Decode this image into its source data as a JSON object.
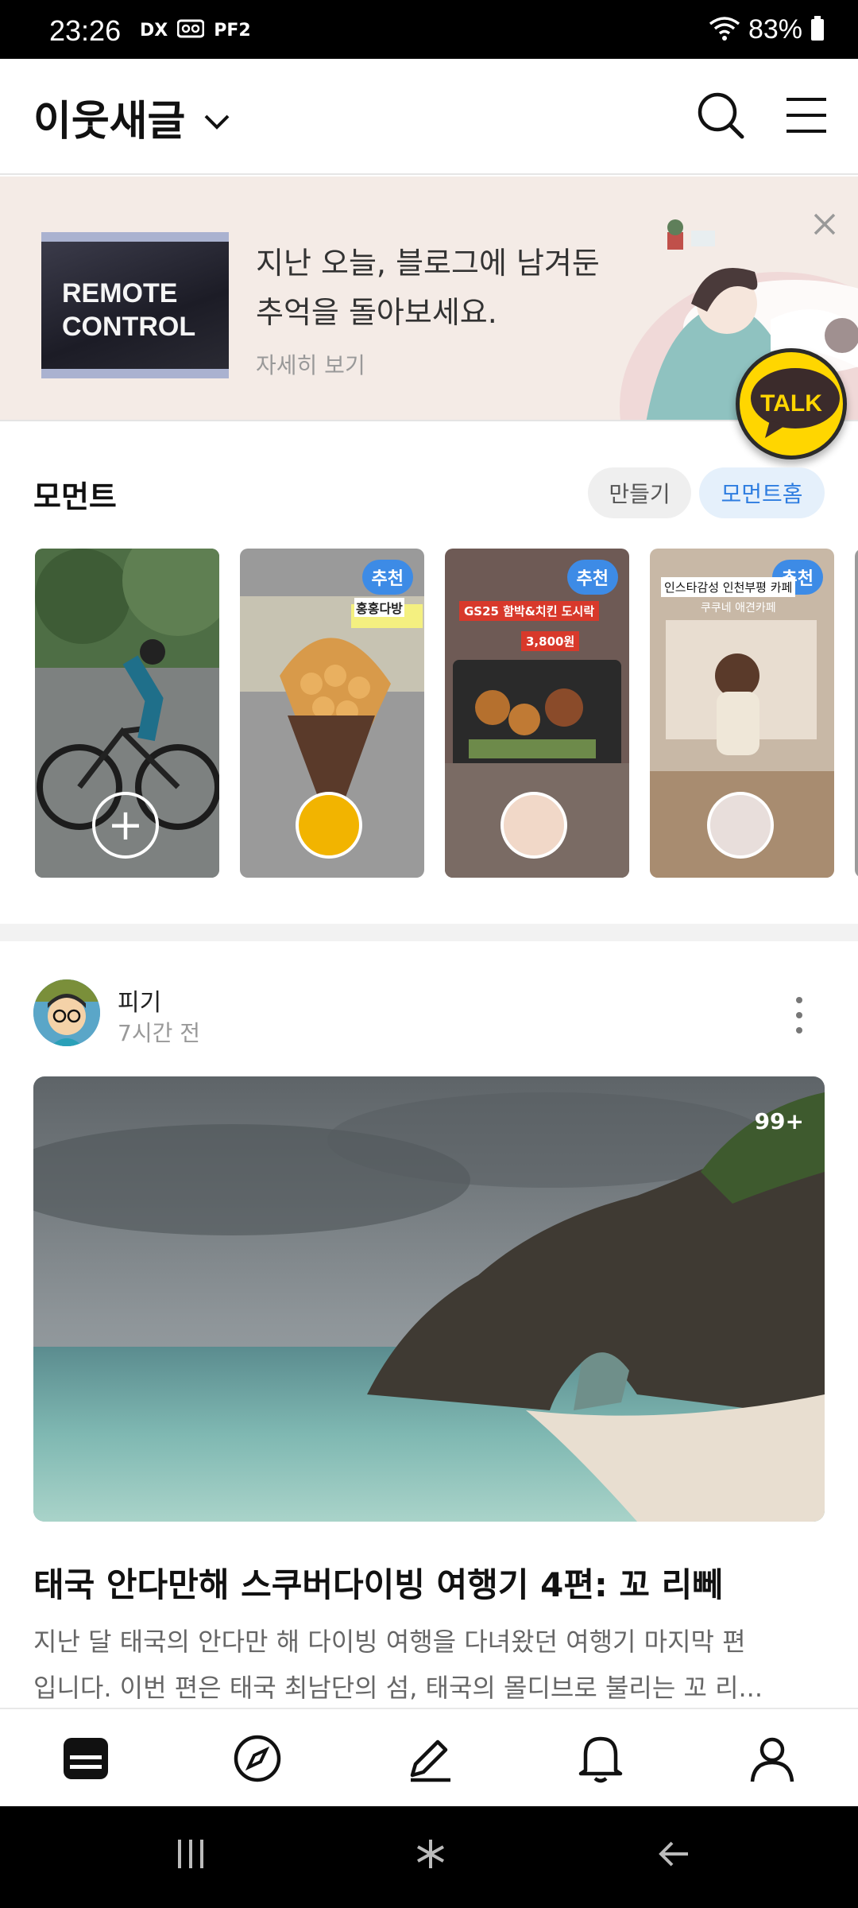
{
  "status_bar": {
    "time": "23:26",
    "icons": [
      "DX",
      "PF2"
    ],
    "battery": "83%"
  },
  "header": {
    "title": "이웃새글"
  },
  "banner": {
    "line1": "지난 오늘, 블로그에 남겨둔",
    "line2": "추억을 돌아보세요.",
    "link": "자세히 보기",
    "thumb_line1": "REMOTE",
    "thumb_line2": "CONTROL"
  },
  "talk_button": {
    "label": "TALK"
  },
  "moments": {
    "title": "모먼트",
    "make_label": "만들기",
    "home_label": "모먼트홈",
    "badge": "추천",
    "card2_caption": "홍홍다방",
    "card3_tag": "GS25 함박&치킨 도시락",
    "card3_price": "3,800원",
    "card4_caption": "인스타감성 인천부평 카페",
    "card4_sub": "쿠쿠네 애견카페"
  },
  "post": {
    "author": "피기",
    "time": "7시간 전",
    "photo_count": "99+",
    "title": "태국 안다만해 스쿠버다이빙 여행기 4편: 꼬 리뻬",
    "body_line1": "지난 달 태국의 안다만 해 다이빙 여행을 다녀왔던 여행기 마지막 편",
    "body_line2": "입니다. 이번 편은 태국 최남단의 섬, 태국의 몰디브로 불리는 꼬 리..."
  },
  "colors": {
    "accent": "#2e7de0",
    "banner_bg": "#f4ebe6",
    "talk_yellow": "#ffd600"
  }
}
